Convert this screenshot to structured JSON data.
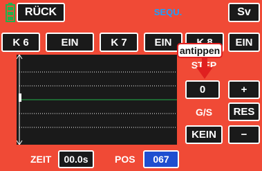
{
  "header": {
    "back_label": "RÜCK",
    "title": "SEQU.",
    "save_label": "Sv"
  },
  "channels": [
    {
      "name": "K 6",
      "state": "EIN"
    },
    {
      "name": "K 7",
      "state": "EIN"
    },
    {
      "name": "K 8",
      "state": "EIN"
    }
  ],
  "callout": {
    "text": "antippen"
  },
  "step": {
    "label": "STEP",
    "value": "0",
    "plus_label": "+",
    "gs_label": "G/S",
    "reset_label": "RES",
    "mode_value": "KEIN",
    "minus_label": "−"
  },
  "footer": {
    "time_label": "ZEIT",
    "time_value": "00.0s",
    "pos_label": "POS",
    "pos_value": "067"
  },
  "colors": {
    "background": "#f04a36",
    "button": "#1a1a1a",
    "accent_blue": "#1f4fd0",
    "battery_green": "#22b14c",
    "arrow_red": "#e02020",
    "title_blue": "#1aa0ff"
  },
  "icons": {
    "battery": "battery-icon",
    "arrow": "arrow-down-icon"
  }
}
